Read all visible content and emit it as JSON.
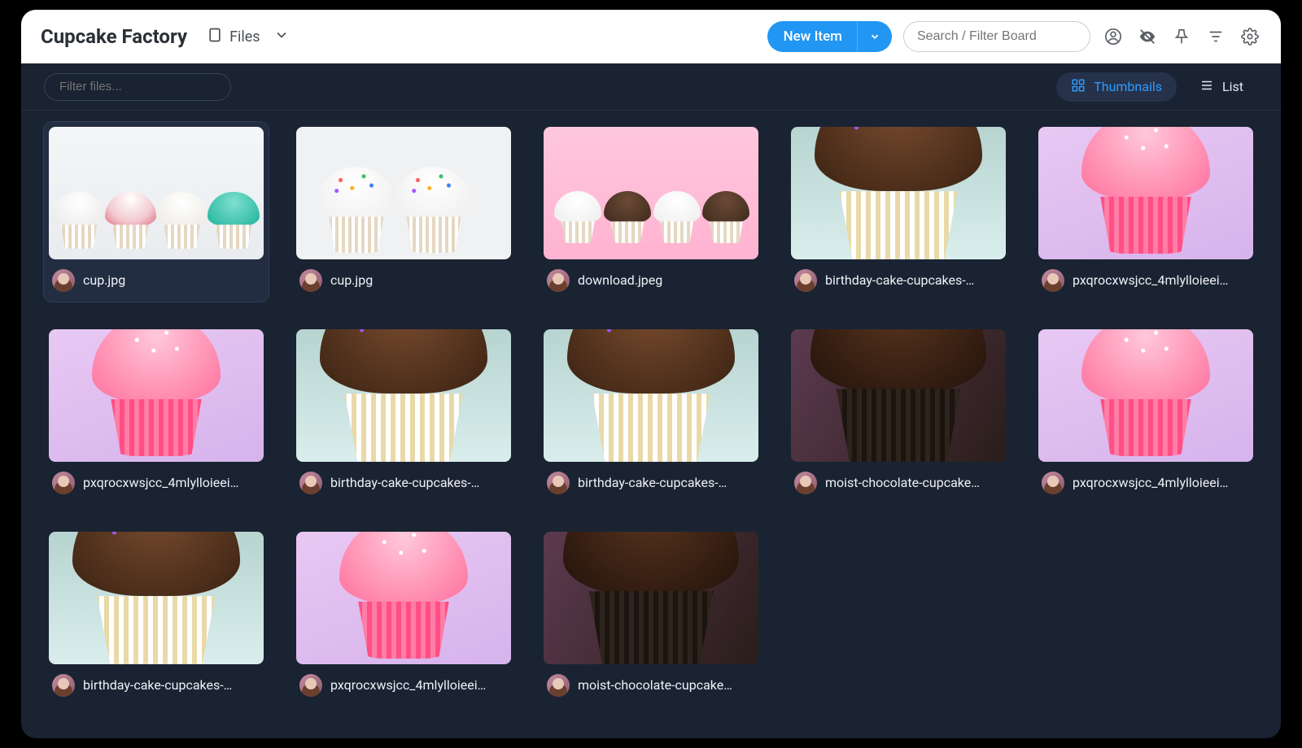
{
  "header": {
    "board_title": "Cupcake Factory",
    "view_label": "Files",
    "new_item_label": "New Item",
    "search_placeholder": "Search / Filter Board"
  },
  "toolbar": {
    "filter_placeholder": "Filter files...",
    "view_thumbnails_label": "Thumbnails",
    "view_list_label": "List"
  },
  "files": [
    {
      "name": "cup.jpg",
      "variant": "group",
      "selected": true
    },
    {
      "name": "cup.jpg",
      "variant": "pair",
      "selected": false
    },
    {
      "name": "download.jpeg",
      "variant": "pinkrow",
      "selected": false
    },
    {
      "name": "birthday-cake-cupcakes-…",
      "variant": "bday",
      "selected": false
    },
    {
      "name": "pxqrocxwsjcc_4mlylloieei…",
      "variant": "pink",
      "selected": false
    },
    {
      "name": "pxqrocxwsjcc_4mlylloieei…",
      "variant": "pink",
      "selected": false
    },
    {
      "name": "birthday-cake-cupcakes-…",
      "variant": "bday",
      "selected": false
    },
    {
      "name": "birthday-cake-cupcakes-…",
      "variant": "bday",
      "selected": false
    },
    {
      "name": "moist-chocolate-cupcake…",
      "variant": "moist",
      "selected": false
    },
    {
      "name": "pxqrocxwsjcc_4mlylloieei…",
      "variant": "pink",
      "selected": false
    },
    {
      "name": "birthday-cake-cupcakes-…",
      "variant": "bday",
      "selected": false
    },
    {
      "name": "pxqrocxwsjcc_4mlylloieei…",
      "variant": "pink",
      "selected": false
    },
    {
      "name": "moist-chocolate-cupcake…",
      "variant": "moist",
      "selected": false
    }
  ]
}
